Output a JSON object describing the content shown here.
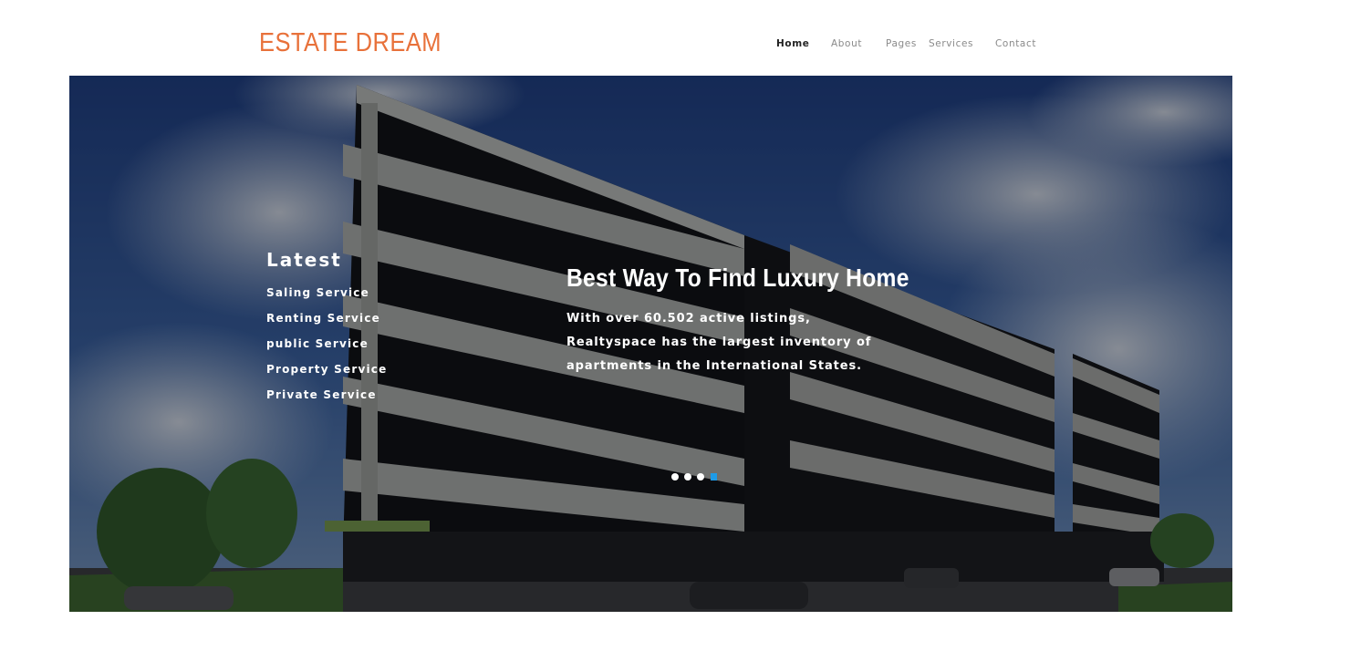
{
  "header": {
    "logo": "ESTATE DREAM",
    "nav": [
      {
        "label": "Home",
        "active": true
      },
      {
        "label": "About",
        "active": false
      },
      {
        "label": "Pages",
        "active": false
      },
      {
        "label": "Services",
        "active": false
      },
      {
        "label": "Contact",
        "active": false
      }
    ]
  },
  "hero": {
    "sidebar": {
      "title": "Latest",
      "items": [
        "Saling Service",
        "Renting Service",
        "public Service",
        "Property Service",
        "Private Service"
      ]
    },
    "caption": {
      "title": "Best Way To Find Luxury Home",
      "lines": [
        "With over 60.502 active listings,",
        "Realtyspace has the largest inventory of",
        "apartments in the International States."
      ]
    },
    "slider": {
      "count": 4,
      "active_index": 3
    }
  },
  "colors": {
    "logo": "#e8713a",
    "active_dot": "#1e9be8",
    "dot": "#ffffff",
    "nav_active": "#222222",
    "nav": "#8a8a8a"
  }
}
